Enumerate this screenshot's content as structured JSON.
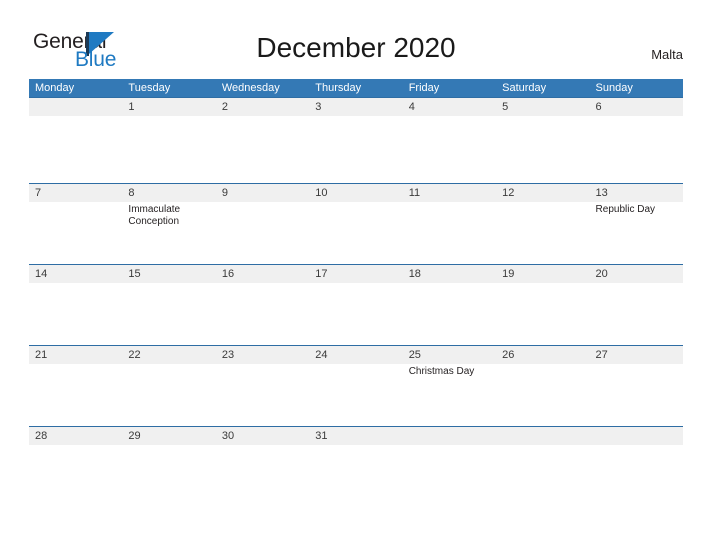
{
  "brand": {
    "name_part1": "General",
    "name_part2": "Blue",
    "mark": "sail-triangle"
  },
  "header": {
    "title": "December 2020",
    "country": "Malta"
  },
  "calendar": {
    "weekdays": [
      "Monday",
      "Tuesday",
      "Wednesday",
      "Thursday",
      "Friday",
      "Saturday",
      "Sunday"
    ],
    "header_color": "#3479b5",
    "day_band_color": "#f0f0f0",
    "row_border_color": "#2e6da4",
    "weeks": [
      {
        "days": [
          {
            "number": "",
            "event": ""
          },
          {
            "number": "1",
            "event": ""
          },
          {
            "number": "2",
            "event": ""
          },
          {
            "number": "3",
            "event": ""
          },
          {
            "number": "4",
            "event": ""
          },
          {
            "number": "5",
            "event": ""
          },
          {
            "number": "6",
            "event": ""
          }
        ]
      },
      {
        "days": [
          {
            "number": "7",
            "event": ""
          },
          {
            "number": "8",
            "event": "Immaculate Conception"
          },
          {
            "number": "9",
            "event": ""
          },
          {
            "number": "10",
            "event": ""
          },
          {
            "number": "11",
            "event": ""
          },
          {
            "number": "12",
            "event": ""
          },
          {
            "number": "13",
            "event": "Republic Day"
          }
        ]
      },
      {
        "days": [
          {
            "number": "14",
            "event": ""
          },
          {
            "number": "15",
            "event": ""
          },
          {
            "number": "16",
            "event": ""
          },
          {
            "number": "17",
            "event": ""
          },
          {
            "number": "18",
            "event": ""
          },
          {
            "number": "19",
            "event": ""
          },
          {
            "number": "20",
            "event": ""
          }
        ]
      },
      {
        "days": [
          {
            "number": "21",
            "event": ""
          },
          {
            "number": "22",
            "event": ""
          },
          {
            "number": "23",
            "event": ""
          },
          {
            "number": "24",
            "event": ""
          },
          {
            "number": "25",
            "event": "Christmas Day"
          },
          {
            "number": "26",
            "event": ""
          },
          {
            "number": "27",
            "event": ""
          }
        ]
      },
      {
        "days": [
          {
            "number": "28",
            "event": ""
          },
          {
            "number": "29",
            "event": ""
          },
          {
            "number": "30",
            "event": ""
          },
          {
            "number": "31",
            "event": ""
          },
          {
            "number": "",
            "event": ""
          },
          {
            "number": "",
            "event": ""
          },
          {
            "number": "",
            "event": ""
          }
        ]
      }
    ]
  }
}
